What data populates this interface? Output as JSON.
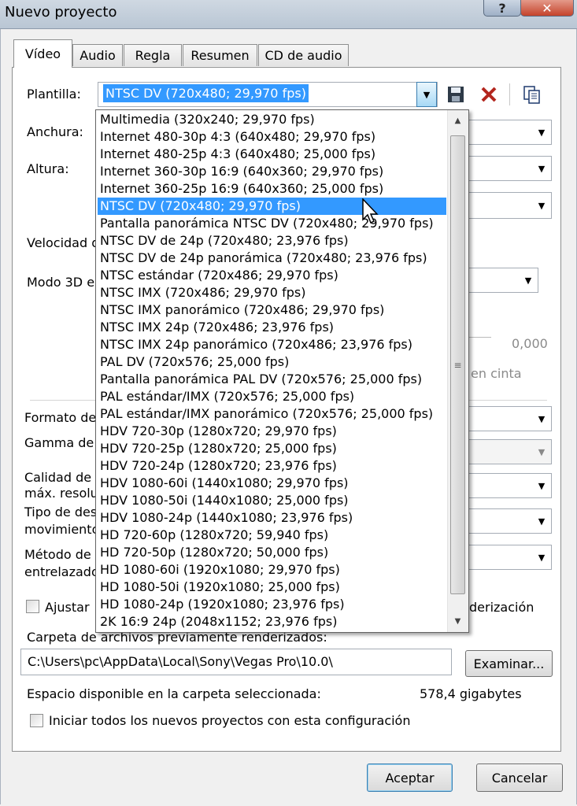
{
  "window": {
    "title": "Nuevo proyecto",
    "help_label": "?",
    "close_label": "✕"
  },
  "tabs": [
    {
      "label": "Vídeo",
      "active": true
    },
    {
      "label": "Audio"
    },
    {
      "label": "Regla"
    },
    {
      "label": "Resumen"
    },
    {
      "label": "CD de audio"
    }
  ],
  "template": {
    "label": "Plantilla:",
    "selected": "NTSC DV (720x480; 29,970 fps)"
  },
  "dropdown_items": [
    "Multimedia (320x240; 29,970 fps)",
    "Internet 480-30p 4:3 (640x480; 29,970 fps)",
    "Internet 480-25p 4:3 (640x480; 25,000 fps)",
    "Internet 360-30p 16:9 (640x360; 29,970 fps)",
    "Internet 360-25p 16:9 (640x360; 25,000 fps)",
    "NTSC DV (720x480; 29,970 fps)",
    "Pantalla panorámica NTSC DV (720x480; 29,970 fps)",
    "NTSC DV de 24p (720x480; 23,976 fps)",
    "NTSC DV de 24p panorámica (720x480; 23,976 fps)",
    "NTSC estándar (720x486; 29,970 fps)",
    "NTSC IMX (720x486; 29,970 fps)",
    "NTSC IMX panorámico (720x486; 29,970 fps)",
    "NTSC IMX 24p (720x486; 23,976 fps)",
    "NTSC IMX 24p panorámico (720x486; 23,976 fps)",
    "PAL DV (720x576; 25,000 fps)",
    "Pantalla panorámica PAL DV (720x576; 25,000 fps)",
    "PAL estándar/IMX (720x576; 25,000 fps)",
    "PAL estándar/IMX panorámico (720x576; 25,000 fps)",
    "HDV 720-30p (1280x720; 29,970 fps)",
    "HDV 720-25p (1280x720; 25,000 fps)",
    "HDV 720-24p (1280x720; 23,976 fps)",
    "HDV 1080-60i (1440x1080; 29,970 fps)",
    "HDV 1080-50i (1440x1080; 25,000 fps)",
    "HDV 1080-24p (1440x1080; 23,976 fps)",
    "HD 720-60p (1280x720; 59,940 fps)",
    "HD 720-50p (1280x720; 50,000 fps)",
    "HD 1080-60i (1920x1080; 29,970 fps)",
    "HD 1080-50i (1920x1080; 25,000 fps)",
    "HD 1080-24p (1920x1080; 23,976 fps)",
    "2K 16:9 24p (2048x1152; 23,976 fps)"
  ],
  "fields": {
    "anchura": "Anchura:",
    "altura": "Altura:",
    "velocidad": "Velocidad d",
    "modo3d": "Modo 3D e",
    "formato": "Formato de",
    "gamma": "Gamma de",
    "calidad_1": "Calidad de",
    "calidad_2": "máx. resolu",
    "tipo_1": "Tipo de des",
    "tipo_2": "movimiento",
    "metodo_1": "Método de",
    "metodo_2": "entrelazado",
    "ajustar": "Ajustar",
    "slider_value": "0,000",
    "en_cinta": "en cinta",
    "derizacion": "derización"
  },
  "folder": {
    "label": "Carpeta de archivos previamente renderizados:",
    "path": "C:\\Users\\pc\\AppData\\Local\\Sony\\Vegas Pro\\10.0\\",
    "browse": "Examinar...",
    "space_label": "Espacio disponible en la carpeta seleccionada:",
    "space_value": "578,4 gigabytes"
  },
  "init_all_label": "Iniciar todos los nuevos proyectos con esta configuración",
  "buttons": {
    "accept": "Aceptar",
    "cancel": "Cancelar"
  },
  "icons": [
    "save-icon",
    "delete-icon",
    "copy-icon"
  ],
  "colors": {
    "selection": "#3399ff"
  }
}
